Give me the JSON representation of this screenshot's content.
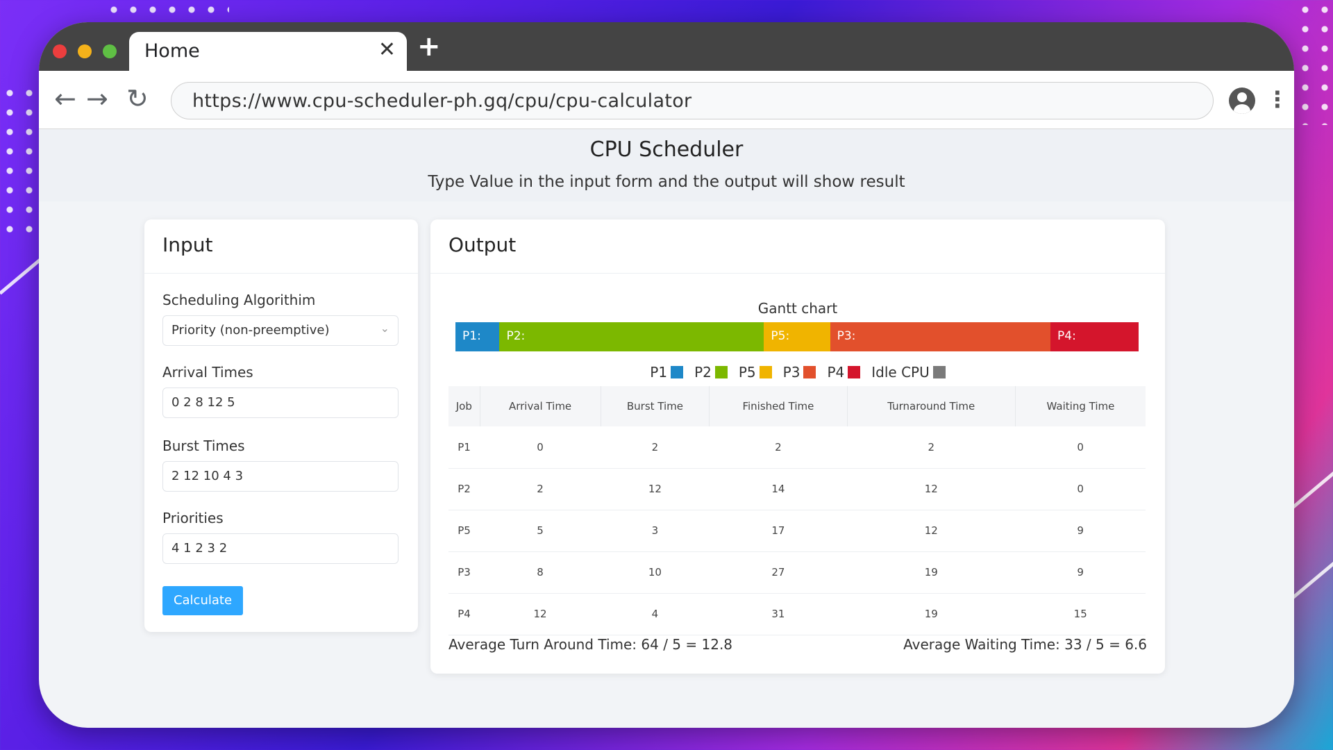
{
  "browser": {
    "tab_title": "Home",
    "tab_close": "✕",
    "new_tab": "+",
    "back": "←",
    "forward": "→",
    "reload": "↻",
    "url": "https://www.cpu-scheduler-ph.gq/cpu/cpu-calculator",
    "menu": "⋮",
    "traffic_lights": [
      "#ec3e3e",
      "#f5b21a",
      "#5fbf44"
    ]
  },
  "page": {
    "title": "CPU Scheduler",
    "subtitle": "Type Value in the input form and the output will show result"
  },
  "input": {
    "header": "Input",
    "algorithm_label": "Scheduling Algorithim",
    "algorithm_value": "Priority (non-preemptive)",
    "arrival_label": "Arrival Times",
    "arrival_value": "0 2 8 12 5",
    "burst_label": "Burst Times",
    "burst_value": "2 12 10 4 3",
    "priorities_label": "Priorities",
    "priorities_value": "4 1 2 3 2",
    "calculate_label": "Calculate",
    "accent": "#2ea7ff"
  },
  "output": {
    "header": "Output",
    "gantt": {
      "title": "Gantt chart",
      "total_time": 31,
      "segments": [
        {
          "label": "P1:",
          "start": 0,
          "end": 2,
          "color": "#1e88c8"
        },
        {
          "label": "P2:",
          "start": 2,
          "end": 14,
          "color": "#7cb800"
        },
        {
          "label": "P5:",
          "start": 14,
          "end": 17,
          "color": "#f0b400"
        },
        {
          "label": "P3:",
          "start": 17,
          "end": 27,
          "color": "#e2502c"
        },
        {
          "label": "P4:",
          "start": 27,
          "end": 31,
          "color": "#d4152c"
        }
      ]
    },
    "legend": [
      {
        "label": "P1",
        "color": "#1e88c8"
      },
      {
        "label": "P2",
        "color": "#7cb800"
      },
      {
        "label": "P5",
        "color": "#f0b400"
      },
      {
        "label": "P3",
        "color": "#e2502c"
      },
      {
        "label": "P4",
        "color": "#d4152c"
      },
      {
        "label": "Idle CPU",
        "color": "#7a7a7a"
      }
    ],
    "table": {
      "headers": [
        "Job",
        "Arrival Time",
        "Burst Time",
        "Finished Time",
        "Turnaround Time",
        "Waiting Time"
      ],
      "rows": [
        [
          "P1",
          "0",
          "2",
          "2",
          "2",
          "0"
        ],
        [
          "P2",
          "2",
          "12",
          "14",
          "12",
          "0"
        ],
        [
          "P5",
          "5",
          "3",
          "17",
          "12",
          "9"
        ],
        [
          "P3",
          "8",
          "10",
          "27",
          "19",
          "9"
        ],
        [
          "P4",
          "12",
          "4",
          "31",
          "19",
          "15"
        ]
      ]
    },
    "avg_turnaround": "Average Turn Around Time: 64 / 5 = 12.8",
    "avg_waiting": "Average Waiting Time: 33 / 5 = 6.6"
  }
}
